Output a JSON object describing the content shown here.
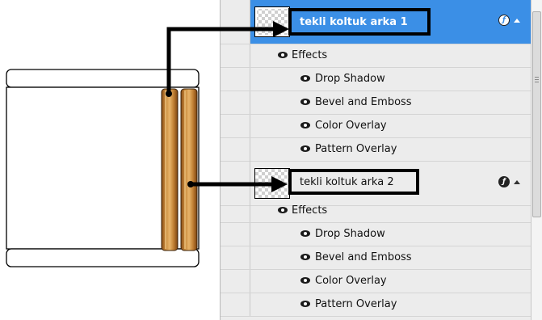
{
  "layers_panel": {
    "layers": [
      {
        "name": "tekli koltuk arka 1",
        "selected": true,
        "effects_label": "Effects",
        "effects": [
          "Drop Shadow",
          "Bevel and Emboss",
          "Color Overlay",
          "Pattern Overlay"
        ]
      },
      {
        "name": "tekli koltuk arka 2",
        "selected": false,
        "effects_label": "Effects",
        "effects": [
          "Drop Shadow",
          "Bevel and Emboss",
          "Color Overlay",
          "Pattern Overlay"
        ]
      }
    ],
    "fx_badge_icon": "layer-effects-icon",
    "collapse_icon": "triangle-up-icon",
    "eye_icon": "eye-icon"
  },
  "colors": {
    "selection_blue": "#3b8fe6",
    "wood_light": "#d79a4a",
    "wood_dark": "#8a4e16",
    "annotation": "#000000"
  }
}
